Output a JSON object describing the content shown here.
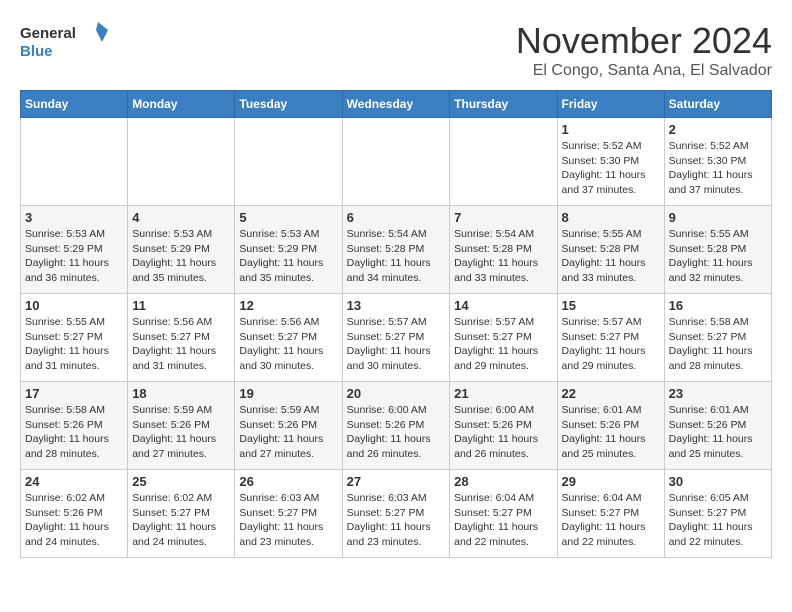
{
  "logo": {
    "line1": "General",
    "line2": "Blue"
  },
  "header": {
    "month": "November 2024",
    "location": "El Congo, Santa Ana, El Salvador"
  },
  "weekdays": [
    "Sunday",
    "Monday",
    "Tuesday",
    "Wednesday",
    "Thursday",
    "Friday",
    "Saturday"
  ],
  "weeks": [
    [
      {
        "day": "",
        "info": ""
      },
      {
        "day": "",
        "info": ""
      },
      {
        "day": "",
        "info": ""
      },
      {
        "day": "",
        "info": ""
      },
      {
        "day": "",
        "info": ""
      },
      {
        "day": "1",
        "info": "Sunrise: 5:52 AM\nSunset: 5:30 PM\nDaylight: 11 hours and 37 minutes."
      },
      {
        "day": "2",
        "info": "Sunrise: 5:52 AM\nSunset: 5:30 PM\nDaylight: 11 hours and 37 minutes."
      }
    ],
    [
      {
        "day": "3",
        "info": "Sunrise: 5:53 AM\nSunset: 5:29 PM\nDaylight: 11 hours and 36 minutes."
      },
      {
        "day": "4",
        "info": "Sunrise: 5:53 AM\nSunset: 5:29 PM\nDaylight: 11 hours and 35 minutes."
      },
      {
        "day": "5",
        "info": "Sunrise: 5:53 AM\nSunset: 5:29 PM\nDaylight: 11 hours and 35 minutes."
      },
      {
        "day": "6",
        "info": "Sunrise: 5:54 AM\nSunset: 5:28 PM\nDaylight: 11 hours and 34 minutes."
      },
      {
        "day": "7",
        "info": "Sunrise: 5:54 AM\nSunset: 5:28 PM\nDaylight: 11 hours and 33 minutes."
      },
      {
        "day": "8",
        "info": "Sunrise: 5:55 AM\nSunset: 5:28 PM\nDaylight: 11 hours and 33 minutes."
      },
      {
        "day": "9",
        "info": "Sunrise: 5:55 AM\nSunset: 5:28 PM\nDaylight: 11 hours and 32 minutes."
      }
    ],
    [
      {
        "day": "10",
        "info": "Sunrise: 5:55 AM\nSunset: 5:27 PM\nDaylight: 11 hours and 31 minutes."
      },
      {
        "day": "11",
        "info": "Sunrise: 5:56 AM\nSunset: 5:27 PM\nDaylight: 11 hours and 31 minutes."
      },
      {
        "day": "12",
        "info": "Sunrise: 5:56 AM\nSunset: 5:27 PM\nDaylight: 11 hours and 30 minutes."
      },
      {
        "day": "13",
        "info": "Sunrise: 5:57 AM\nSunset: 5:27 PM\nDaylight: 11 hours and 30 minutes."
      },
      {
        "day": "14",
        "info": "Sunrise: 5:57 AM\nSunset: 5:27 PM\nDaylight: 11 hours and 29 minutes."
      },
      {
        "day": "15",
        "info": "Sunrise: 5:57 AM\nSunset: 5:27 PM\nDaylight: 11 hours and 29 minutes."
      },
      {
        "day": "16",
        "info": "Sunrise: 5:58 AM\nSunset: 5:27 PM\nDaylight: 11 hours and 28 minutes."
      }
    ],
    [
      {
        "day": "17",
        "info": "Sunrise: 5:58 AM\nSunset: 5:26 PM\nDaylight: 11 hours and 28 minutes."
      },
      {
        "day": "18",
        "info": "Sunrise: 5:59 AM\nSunset: 5:26 PM\nDaylight: 11 hours and 27 minutes."
      },
      {
        "day": "19",
        "info": "Sunrise: 5:59 AM\nSunset: 5:26 PM\nDaylight: 11 hours and 27 minutes."
      },
      {
        "day": "20",
        "info": "Sunrise: 6:00 AM\nSunset: 5:26 PM\nDaylight: 11 hours and 26 minutes."
      },
      {
        "day": "21",
        "info": "Sunrise: 6:00 AM\nSunset: 5:26 PM\nDaylight: 11 hours and 26 minutes."
      },
      {
        "day": "22",
        "info": "Sunrise: 6:01 AM\nSunset: 5:26 PM\nDaylight: 11 hours and 25 minutes."
      },
      {
        "day": "23",
        "info": "Sunrise: 6:01 AM\nSunset: 5:26 PM\nDaylight: 11 hours and 25 minutes."
      }
    ],
    [
      {
        "day": "24",
        "info": "Sunrise: 6:02 AM\nSunset: 5:26 PM\nDaylight: 11 hours and 24 minutes."
      },
      {
        "day": "25",
        "info": "Sunrise: 6:02 AM\nSunset: 5:27 PM\nDaylight: 11 hours and 24 minutes."
      },
      {
        "day": "26",
        "info": "Sunrise: 6:03 AM\nSunset: 5:27 PM\nDaylight: 11 hours and 23 minutes."
      },
      {
        "day": "27",
        "info": "Sunrise: 6:03 AM\nSunset: 5:27 PM\nDaylight: 11 hours and 23 minutes."
      },
      {
        "day": "28",
        "info": "Sunrise: 6:04 AM\nSunset: 5:27 PM\nDaylight: 11 hours and 22 minutes."
      },
      {
        "day": "29",
        "info": "Sunrise: 6:04 AM\nSunset: 5:27 PM\nDaylight: 11 hours and 22 minutes."
      },
      {
        "day": "30",
        "info": "Sunrise: 6:05 AM\nSunset: 5:27 PM\nDaylight: 11 hours and 22 minutes."
      }
    ]
  ]
}
